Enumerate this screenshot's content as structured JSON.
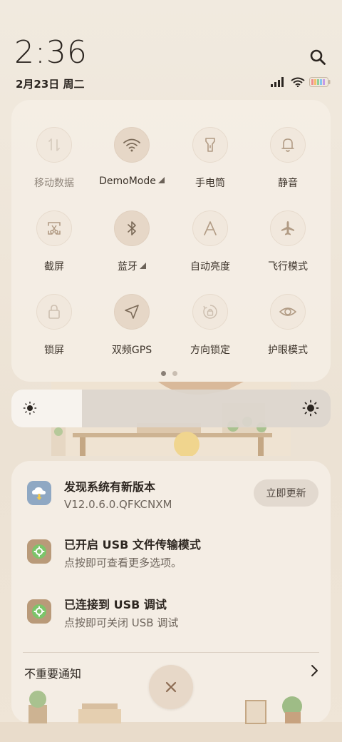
{
  "status": {
    "time": "2:36",
    "date": "2月23日 周二"
  },
  "quick_settings": {
    "tiles": [
      {
        "label": "移动数据",
        "icon": "mobile-data-icon",
        "active": false,
        "dim": true
      },
      {
        "label": "DemoMode",
        "icon": "wifi-icon",
        "active": true,
        "expandable": true
      },
      {
        "label": "手电筒",
        "icon": "flashlight-icon",
        "active": false
      },
      {
        "label": "静音",
        "icon": "bell-icon",
        "active": false
      },
      {
        "label": "截屏",
        "icon": "screenshot-icon",
        "active": false
      },
      {
        "label": "蓝牙",
        "icon": "bluetooth-icon",
        "active": true,
        "expandable": true
      },
      {
        "label": "自动亮度",
        "icon": "auto-brightness-icon",
        "active": false
      },
      {
        "label": "飞行模式",
        "icon": "airplane-icon",
        "active": false
      },
      {
        "label": "锁屏",
        "icon": "lock-icon",
        "active": false
      },
      {
        "label": "双频GPS",
        "icon": "location-arrow-icon",
        "active": true
      },
      {
        "label": "方向锁定",
        "icon": "rotation-lock-icon",
        "active": false
      },
      {
        "label": "护眼模式",
        "icon": "eye-icon",
        "active": false
      }
    ],
    "page_count": 2,
    "current_page": 1
  },
  "brightness": {
    "level_percent": 22
  },
  "notifications": [
    {
      "title": "发现系统有新版本",
      "body": "V12.0.6.0.QFKCNXM",
      "action": "立即更新",
      "icon": "system-update-icon"
    },
    {
      "title": "已开启 USB 文件传输模式",
      "body": "点按即可查看更多选项。",
      "icon": "android-system-icon"
    },
    {
      "title": "已连接到 USB 调试",
      "body": "点按即可关闭 USB 调试",
      "icon": "android-system-icon"
    }
  ],
  "footer": {
    "nonimportant_label": "不重要通知"
  },
  "colors": {
    "accent_icon": "#7b6a58",
    "panel": "#f5eee5",
    "background": "#efe6da"
  }
}
